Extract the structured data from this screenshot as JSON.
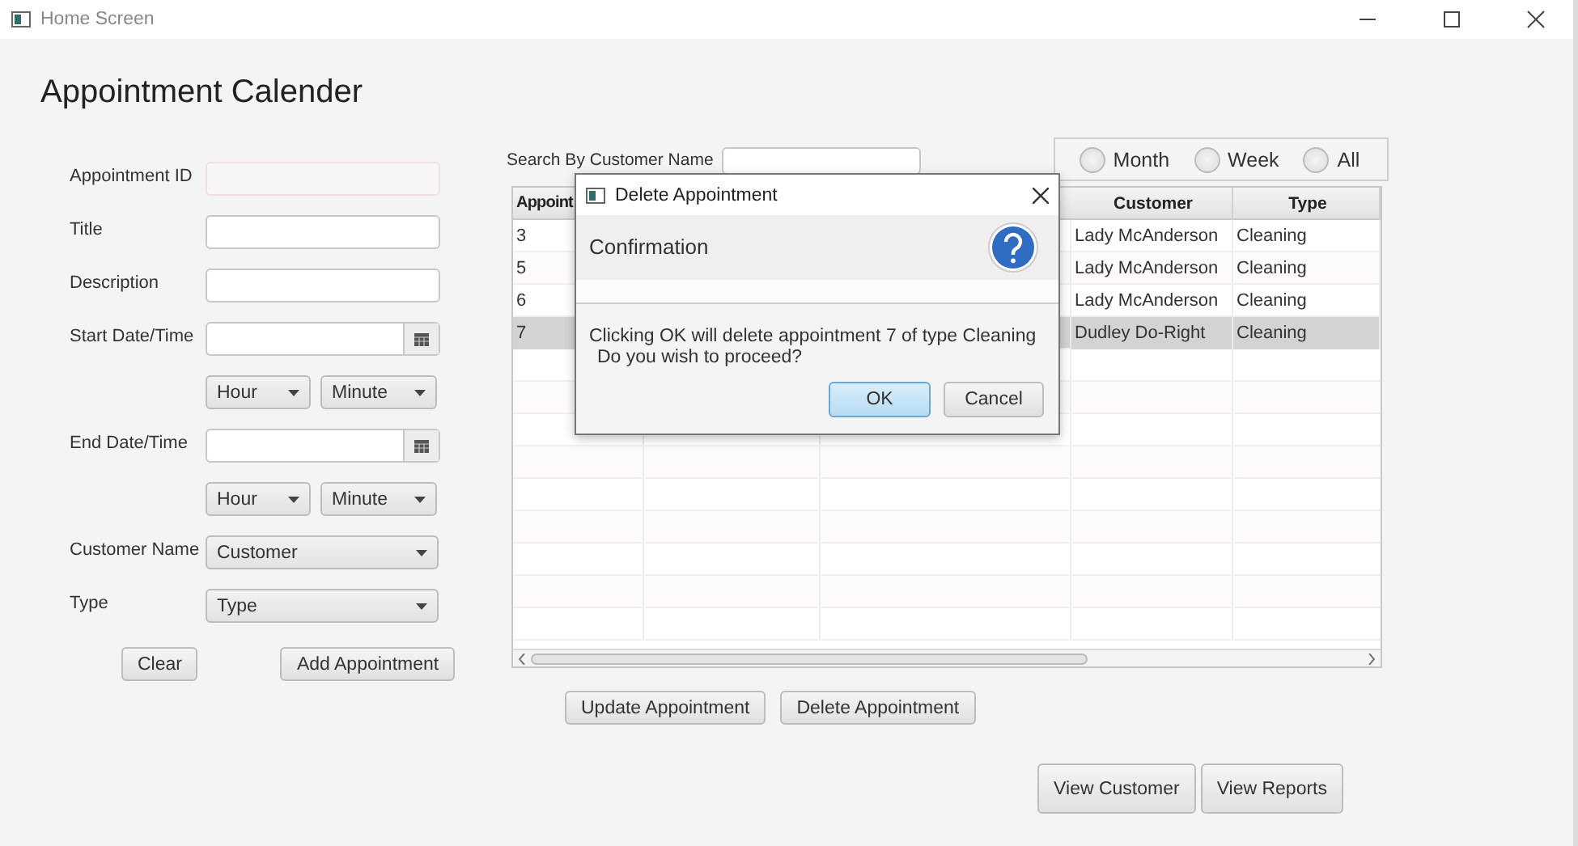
{
  "window": {
    "title": "Home Screen"
  },
  "heading": "Appointment Calender",
  "form": {
    "fields": [
      {
        "kind": "text",
        "label": "Appointment ID",
        "disabled": true
      },
      {
        "kind": "text",
        "label": "Title",
        "disabled": false
      },
      {
        "kind": "text",
        "label": "Description",
        "disabled": false
      },
      {
        "kind": "date",
        "label": "Start Date/Time"
      },
      {
        "kind": "time",
        "hour": "Hour",
        "minute": "Minute"
      },
      {
        "kind": "date",
        "label": "End Date/Time"
      },
      {
        "kind": "time",
        "hour": "Hour",
        "minute": "Minute"
      },
      {
        "kind": "select",
        "label": "Customer Name",
        "value": "Customer"
      },
      {
        "kind": "select",
        "label": "Type",
        "value": "Type"
      }
    ],
    "buttons": [
      "Clear",
      "Add Appointment"
    ]
  },
  "search": {
    "label": "Search By Customer Name"
  },
  "view_filter": [
    {
      "label": "Month",
      "selected": false
    },
    {
      "label": "Week",
      "selected": false
    },
    {
      "label": "All",
      "selected": false
    }
  ],
  "table": {
    "columns": [
      "Appoint",
      "Customer",
      "Type"
    ],
    "rows": [
      {
        "cells": [
          "3",
          "Lady McAnderson",
          "Cleaning"
        ],
        "selected": false
      },
      {
        "cells": [
          "5",
          "Lady McAnderson",
          "Cleaning"
        ],
        "selected": false
      },
      {
        "cells": [
          "6",
          "Lady McAnderson",
          "Cleaning"
        ],
        "selected": false
      },
      {
        "cells": [
          "7",
          "Dudley Do-Right",
          "Cleaning"
        ],
        "selected": true
      }
    ]
  },
  "table_buttons": [
    "Update Appointment",
    "Delete Appointment"
  ],
  "nav_buttons": [
    "View Customer",
    "View Reports"
  ],
  "dialog": {
    "title": "Delete Appointment",
    "header": "Confirmation",
    "message": "Clicking OK will delete appointment 7 of type Cleaning",
    "question": "Do you wish to proceed?",
    "buttons": [
      {
        "label": "OK",
        "default": true
      },
      {
        "label": "Cancel",
        "default": false
      }
    ]
  }
}
